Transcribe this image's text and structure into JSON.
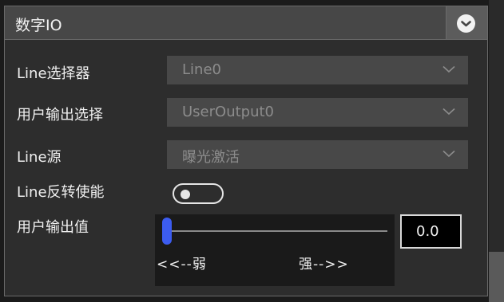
{
  "panel": {
    "title": "数字IO",
    "collapse_icon": "chevron-down-circle-icon"
  },
  "fields": {
    "line_selector": {
      "label": "Line选择器",
      "value": "Line0"
    },
    "user_output_selector": {
      "label": "用户输出选择",
      "value": "UserOutput0"
    },
    "line_source": {
      "label": "Line源",
      "value": "曝光激活"
    },
    "line_inverter": {
      "label": "Line反转使能",
      "state": "off"
    },
    "user_output_value": {
      "label": "用户输出值",
      "weak_label": "<<--弱",
      "strong_label": "强-->>",
      "slider_position": 0.0,
      "value": "0.0"
    }
  },
  "colors": {
    "panel_bg": "#2d2d2d",
    "header_bg": "#474747",
    "select_bg": "#484848",
    "slider_thumb": "#3c5cf0",
    "disabled_text": "#8c8c8c"
  }
}
